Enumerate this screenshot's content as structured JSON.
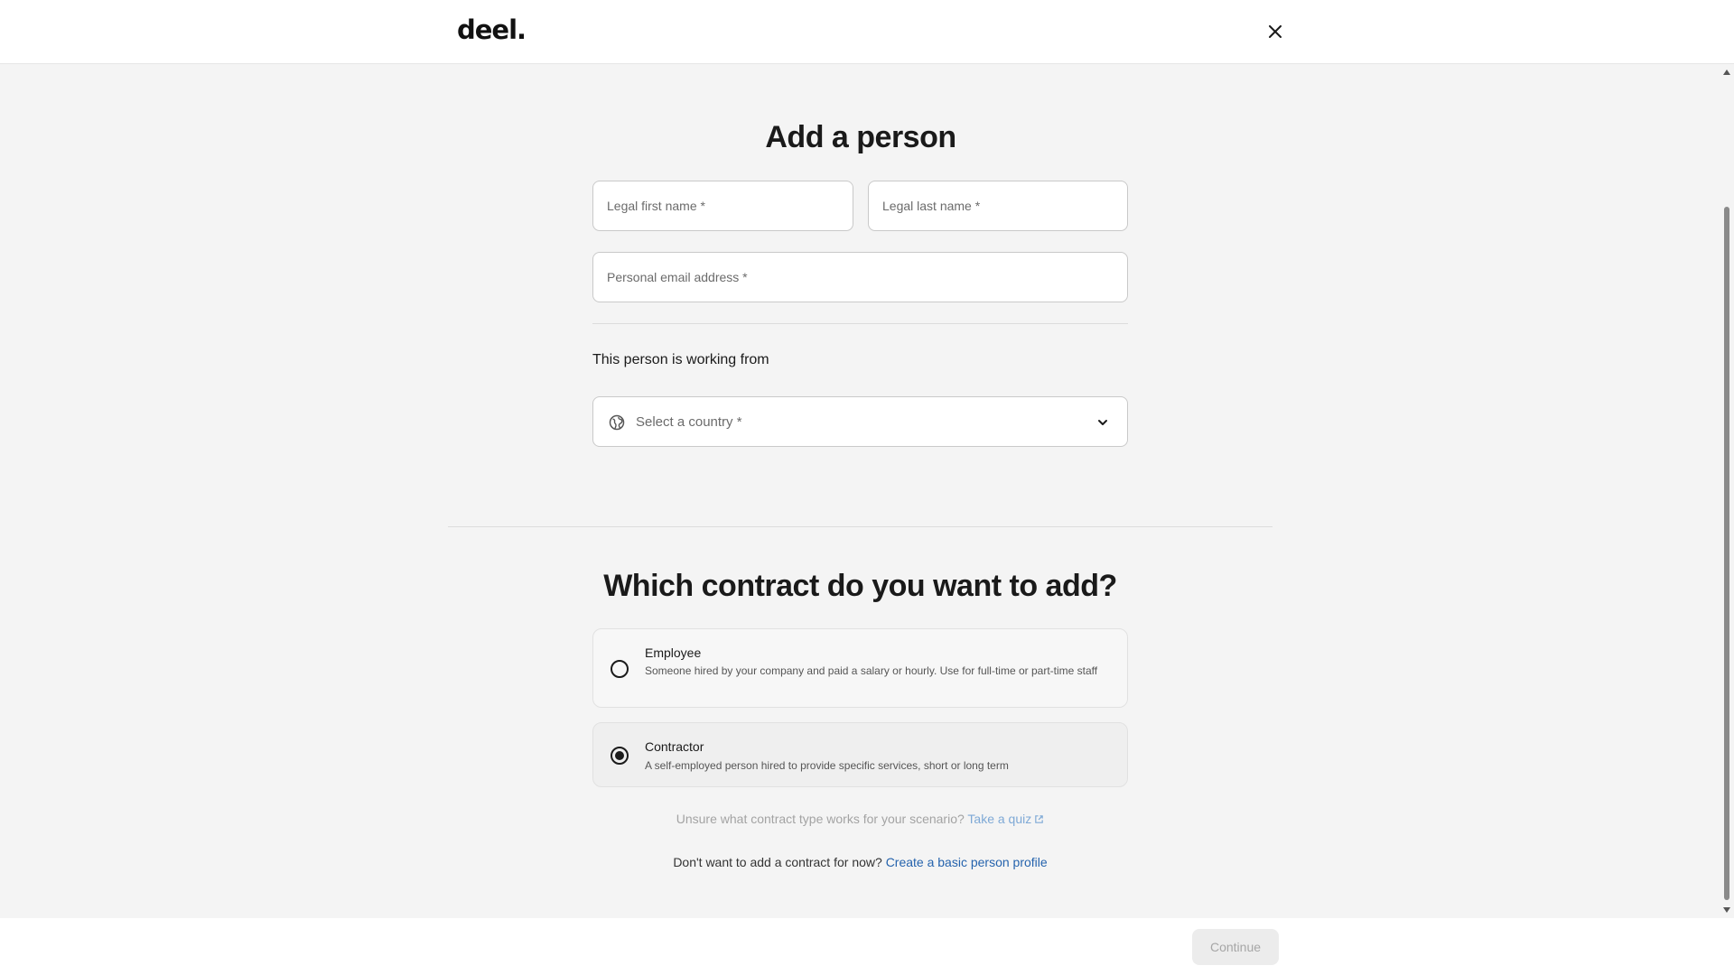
{
  "header": {
    "logo_text": "deel.",
    "close_icon": "close-icon"
  },
  "person": {
    "title": "Add a person",
    "first_name_placeholder": "Legal first name *",
    "last_name_placeholder": "Legal last name *",
    "email_placeholder": "Personal email address *",
    "working_from_label": "This person is working from",
    "country_placeholder": "Select a country *",
    "country_icon": "globe-icon",
    "dropdown_icon": "chevron-down-icon"
  },
  "contract": {
    "question": "Which contract do you want to add?",
    "options": [
      {
        "title": "Employee",
        "description": "Someone hired by your company and paid a salary or hourly. Use for full-time or part-time staff",
        "selected": false
      },
      {
        "title": "Contractor",
        "description": "A self-employed person hired to provide specific services, short or long term",
        "selected": true
      }
    ],
    "quiz_prompt": "Unsure what contract type works for your scenario?",
    "quiz_link": "Take a quiz",
    "quiz_icon": "external-link-icon",
    "profile_prompt": "Don't want to add a contract for now?",
    "profile_link": "Create a basic person profile"
  },
  "footer": {
    "continue_label": "Continue",
    "continue_enabled": false
  },
  "colors": {
    "link": "#2563ad",
    "link_muted": "#7ea9d6",
    "page_bg": "#f4f4f4",
    "button_disabled_bg": "#ececec"
  }
}
